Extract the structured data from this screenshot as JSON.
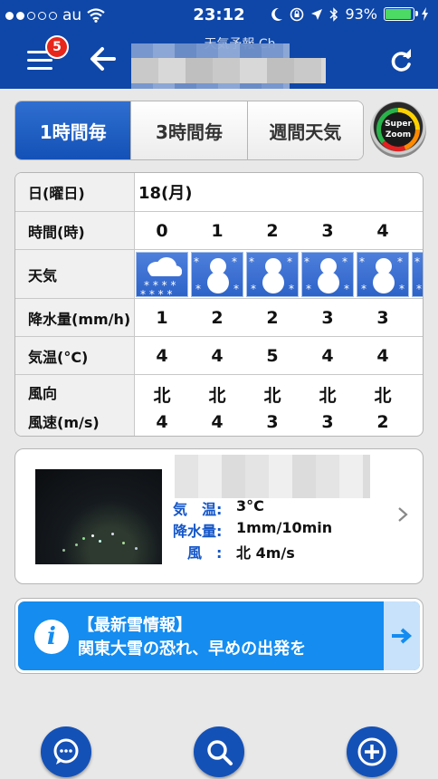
{
  "status_bar": {
    "carrier": "au",
    "time": "23:12",
    "battery_percent": "93%",
    "signal_bars_filled": 2,
    "signal_bars_total": 5
  },
  "nav": {
    "title": "天気予報 Ch",
    "badge_count": "5"
  },
  "tabs": [
    {
      "label": "1時間毎",
      "active": true
    },
    {
      "label": "3時間毎",
      "active": false
    },
    {
      "label": "週間天気",
      "active": false
    }
  ],
  "super_zoom": {
    "line1": "Super",
    "line2": "Zoom"
  },
  "forecast": {
    "labels": {
      "day": "日(曜日)",
      "hour": "時間(時)",
      "weather": "天気",
      "precip": "降水量(mm/h)",
      "temp": "気温(°C)",
      "wind_dir": "風向",
      "wind_speed": "風速(m/s)"
    },
    "day_value": "18(月)",
    "hours": [
      "0",
      "1",
      "2",
      "3",
      "4"
    ],
    "weather_icons": [
      "cloud-snow-icon",
      "snowman-icon",
      "snowman-icon",
      "snowman-icon",
      "snowman-icon"
    ],
    "precip": [
      "1",
      "2",
      "2",
      "3",
      "3"
    ],
    "temp": [
      "4",
      "4",
      "5",
      "4",
      "4"
    ],
    "wind_dir": [
      "北",
      "北",
      "北",
      "北",
      "北"
    ],
    "wind_speed": [
      "4",
      "4",
      "3",
      "3",
      "2"
    ]
  },
  "camera": {
    "temp_label": "気　温:",
    "temp_value": "3°C",
    "precip_label": "降水量:",
    "precip_value": "1mm/10min",
    "wind_label": "風　:",
    "wind_value": "北 4m/s"
  },
  "banner": {
    "title": "【最新雪情報】",
    "text": "関東大雪の恐れ、早めの出発を"
  },
  "colors": {
    "nav_blue": "#0f47a8",
    "active_tab": "#1451b7",
    "banner_blue": "#148cf0",
    "label_blue": "#1456c8"
  }
}
